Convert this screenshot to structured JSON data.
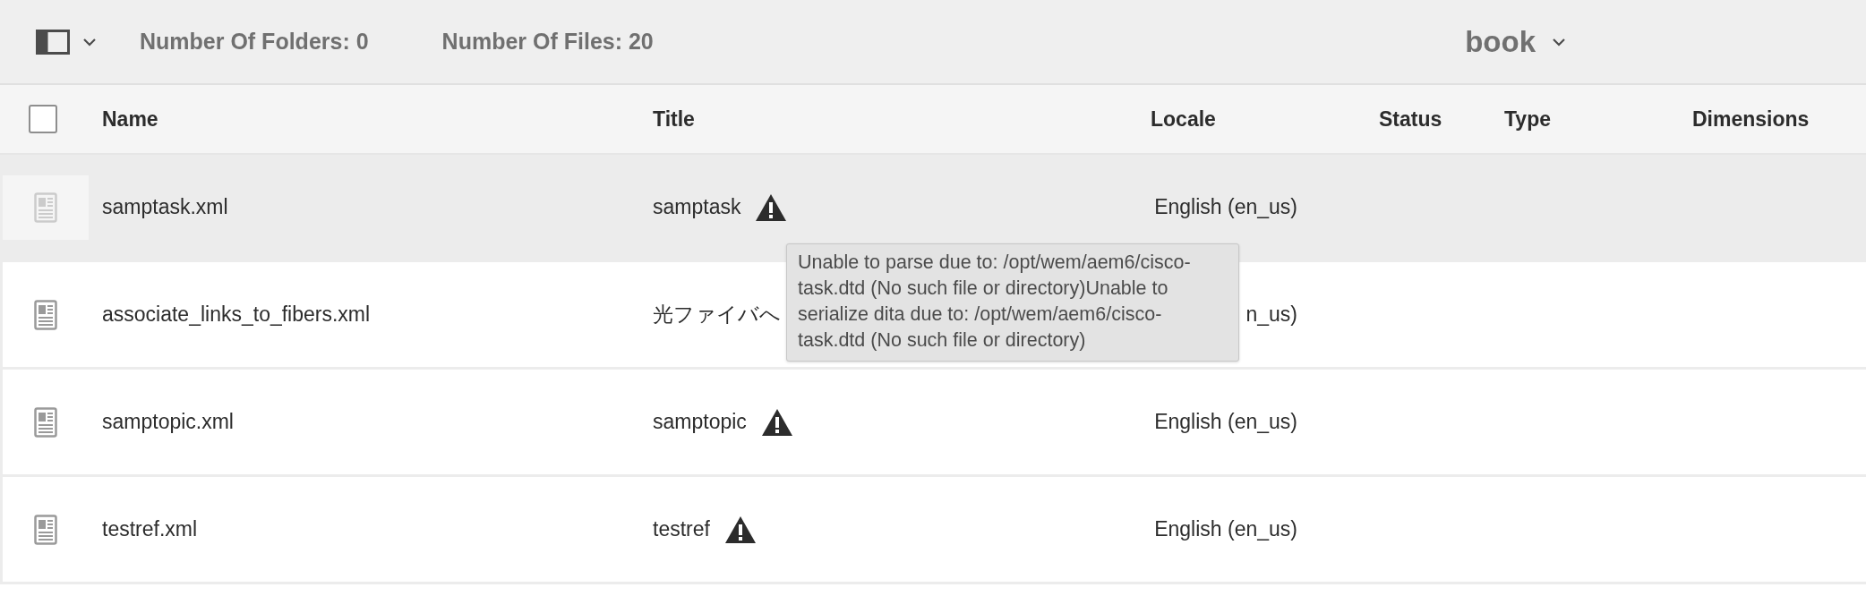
{
  "toolbar": {
    "folders_label": "Number Of Folders:",
    "folders_count": "0",
    "files_label": "Number Of Files:",
    "files_count": "20",
    "collection": "book"
  },
  "table": {
    "select_all": {
      "checked": false
    },
    "columns": [
      "Name",
      "Title",
      "Locale",
      "Status",
      "Type",
      "Dimensions"
    ],
    "rows": [
      {
        "name": "samptask.xml",
        "title": "samptask",
        "warning": true,
        "locale": "English (en_us)",
        "selected": true
      },
      {
        "name": "associate_links_to_fibers.xml",
        "title": "光ファイバへ",
        "locale": "n_us)",
        "selected": false
      },
      {
        "name": "samptopic.xml",
        "title": "samptopic",
        "warning": true,
        "locale": "English (en_us)",
        "selected": false
      },
      {
        "name": "testref.xml",
        "title": "testref",
        "warning": true,
        "locale": "English (en_us)",
        "selected": false
      }
    ]
  },
  "tooltip": {
    "text": "Unable to parse due to: /opt/wem/aem6/cisco-task.dtd (No such file or directory)Unable to serialize dita due to: /opt/wem/aem6/cisco-task.dtd (No such file or directory)"
  }
}
